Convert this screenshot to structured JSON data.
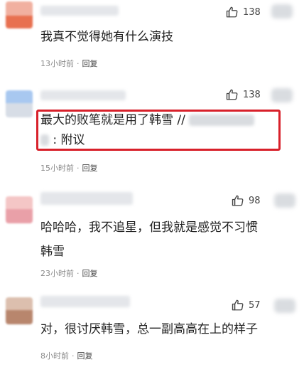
{
  "comments": [
    {
      "likes": "138",
      "text_lines": [
        "我真不觉得她有什么演技"
      ],
      "time": "13小时前",
      "dot": "·",
      "reply": "回复"
    },
    {
      "likes": "138",
      "text_lines": [
        "最大的败笔就是用了韩雪 //",
        ": 附议"
      ],
      "time": "15小时前",
      "dot": "·",
      "reply": "回复"
    },
    {
      "likes": "98",
      "text_lines": [
        "哈哈哈，我不追星，但我就是感觉不习惯",
        "韩雪"
      ],
      "time": "23小时前",
      "dot": "·",
      "reply": "回复"
    },
    {
      "likes": "57",
      "text_lines": [
        "对，很讨厌韩雪，总一副高高在上的样子"
      ],
      "time": "8小时前",
      "dot": "·",
      "reply": "回复"
    }
  ],
  "colors": {
    "highlight_border": "#d8202a",
    "meta_text": "#8a8a8a"
  },
  "icons": {
    "like": "thumbs-up-icon"
  }
}
